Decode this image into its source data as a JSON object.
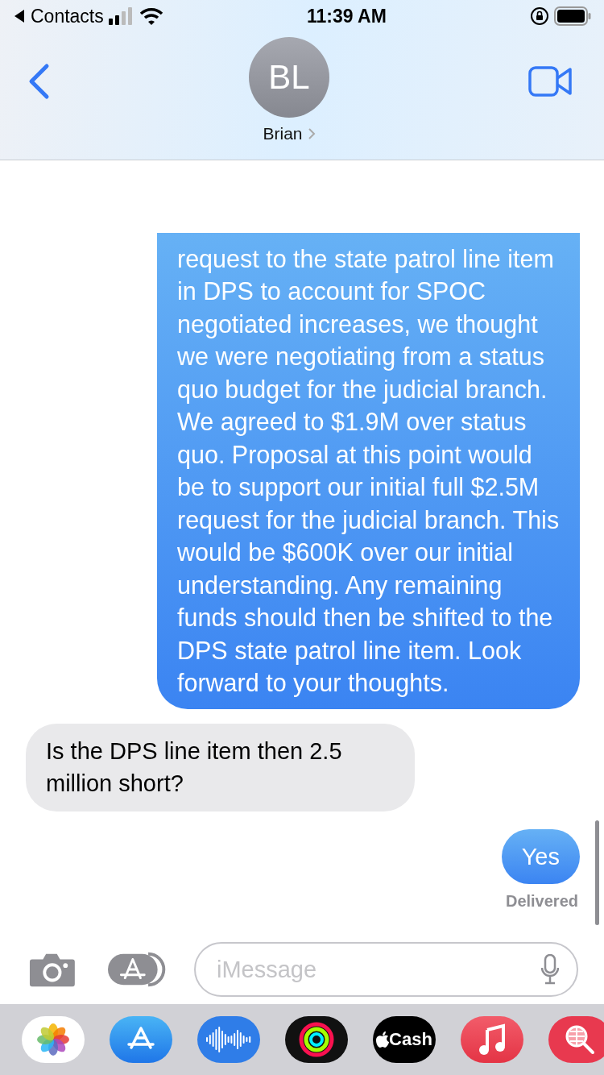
{
  "status_bar": {
    "back_app": "Contacts",
    "time": "11:39 AM"
  },
  "header": {
    "initials": "BL",
    "name": "Brian"
  },
  "messages": [
    {
      "kind": "sent",
      "text": "request to the state patrol line item in DPS to account for SPOC negotiated increases, we thought we were negotiating from a status quo budget for the judicial branch. We agreed to $1.9M over status quo. Proposal at this point would be to support our initial full $2.5M request for the judicial branch. This would be $600K over our initial understanding. Any remaining funds should then be shifted to the DPS state patrol line item. Look forward to your thoughts."
    },
    {
      "kind": "received",
      "text": "Is the DPS line item then 2.5 million short?"
    },
    {
      "kind": "sent",
      "text": "Yes"
    }
  ],
  "delivery_status": "Delivered",
  "composer": {
    "placeholder": "iMessage"
  },
  "app_drawer": [
    {
      "kind": "photos"
    },
    {
      "kind": "appstore"
    },
    {
      "kind": "audio"
    },
    {
      "kind": "activity"
    },
    {
      "kind": "cash",
      "label": "Cash"
    },
    {
      "kind": "music"
    },
    {
      "kind": "search"
    }
  ]
}
